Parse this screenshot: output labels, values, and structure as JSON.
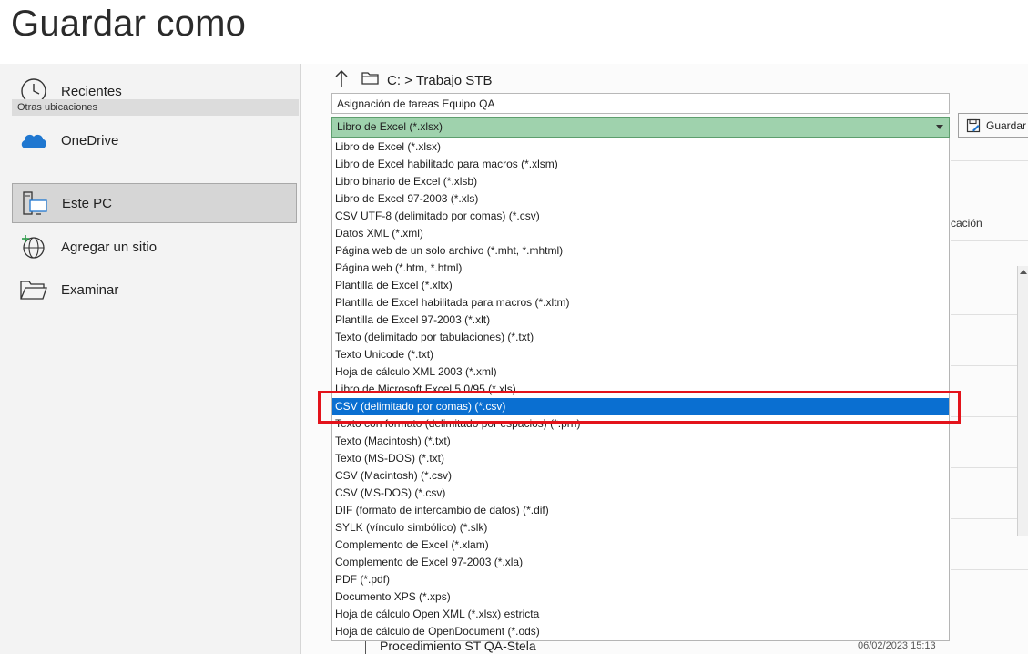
{
  "page": {
    "title": "Guardar como"
  },
  "locations": {
    "recent": "Recientes",
    "onedrive": "OneDrive",
    "section_header": "Otras ubicaciones",
    "this_pc": "Este PC",
    "add_place": "Agregar un sitio",
    "browse": "Examinar",
    "selected": "Este PC"
  },
  "path": {
    "text": "C: > Trabajo STB"
  },
  "filename": {
    "value": "Asignación de tareas Equipo QA"
  },
  "filetype": {
    "selected": "Libro de Excel (*.xlsx)",
    "options": [
      "Libro de Excel (*.xlsx)",
      "Libro de Excel habilitado para macros (*.xlsm)",
      "Libro binario de Excel (*.xlsb)",
      "Libro de Excel 97-2003 (*.xls)",
      "CSV UTF-8 (delimitado por comas) (*.csv)",
      "Datos XML (*.xml)",
      "Página web de un solo archivo (*.mht, *.mhtml)",
      "Página web (*.htm, *.html)",
      "Plantilla de Excel (*.xltx)",
      "Plantilla de Excel habilitada para macros (*.xltm)",
      "Plantilla de Excel 97-2003 (*.xlt)",
      "Texto (delimitado por tabulaciones) (*.txt)",
      "Texto Unicode (*.txt)",
      "Hoja de cálculo XML 2003 (*.xml)",
      "Libro de Microsoft Excel 5.0/95 (*.xls)",
      "CSV (delimitado por comas) (*.csv)",
      "Texto con formato (delimitado por espacios) (*.prn)",
      "Texto (Macintosh) (*.txt)",
      "Texto (MS-DOS) (*.txt)",
      "CSV (Macintosh) (*.csv)",
      "CSV (MS-DOS) (*.csv)",
      "DIF (formato de intercambio de datos) (*.dif)",
      "SYLK (vínculo simbólico) (*.slk)",
      "Complemento de Excel (*.xlam)",
      "Complemento de Excel 97-2003 (*.xla)",
      "PDF (*.pdf)",
      "Documento XPS (*.xps)",
      "Hoja de cálculo Open XML (*.xlsx) estricta",
      "Hoja de cálculo de OpenDocument (*.ods)"
    ],
    "highlighted": "CSV (delimitado por comas) (*.csv)"
  },
  "toolbar": {
    "save_label": "Guardar"
  },
  "background": {
    "column_fragment": "cación",
    "file_row": {
      "name": "Procedimiento ST QA-Stela",
      "date": "06/02/2023 15:13"
    }
  },
  "colors": {
    "accent_green": "#9fd2ad",
    "selection_blue": "#0a6fd1",
    "annotation_red": "#e3131b"
  },
  "icons": {
    "recent": "clock-icon",
    "onedrive": "cloud-icon",
    "this_pc": "computer-icon",
    "add_place": "globe-plus-icon",
    "browse": "folder-open-icon",
    "up": "arrow-up-icon",
    "path_folder": "folder-icon",
    "save": "save-icon",
    "dropdown": "chevron-down-icon"
  }
}
